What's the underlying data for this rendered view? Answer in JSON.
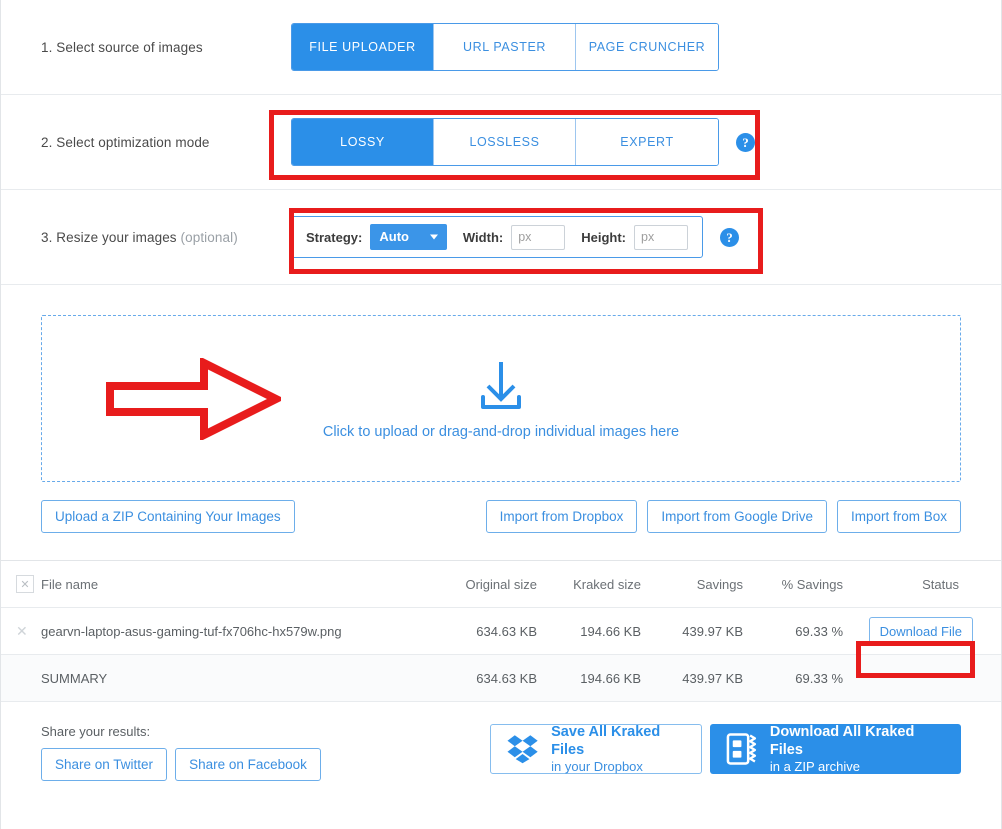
{
  "steps": [
    {
      "label_num": "1. Select source of images",
      "optional": "",
      "options": [
        "FILE UPLOADER",
        "URL PASTER",
        "PAGE CRUNCHER"
      ],
      "selected": "FILE UPLOADER"
    },
    {
      "label_num": "2. Select optimization mode",
      "optional": "",
      "options": [
        "LOSSY",
        "LOSSLESS",
        "EXPERT"
      ],
      "selected": "LOSSY",
      "help": "?"
    },
    {
      "label_num": "3. Resize your images",
      "optional": "(optional)",
      "help": "?"
    }
  ],
  "resize": {
    "strategy_label": "Strategy:",
    "strategy_value": "Auto",
    "width_label": "Width:",
    "width_value": "",
    "width_placeholder": "px",
    "height_label": "Height:",
    "height_value": "",
    "height_placeholder": "px"
  },
  "dropzone": {
    "text": "Click to upload or drag-and-drop individual images here",
    "icon": "download-arrow-icon"
  },
  "import_buttons": {
    "zip": "Upload a ZIP Containing Your Images",
    "dropbox": "Import from Dropbox",
    "google_drive": "Import from Google Drive",
    "box": "Import from Box"
  },
  "table": {
    "headers": {
      "file_name": "File name",
      "original_size": "Original size",
      "kraked_size": "Kraked size",
      "savings": "Savings",
      "pct_savings": "% Savings",
      "status": "Status"
    },
    "rows": [
      {
        "file_name": "gearvn-laptop-asus-gaming-tuf-fx706hc-hx579w.png",
        "original_size": "634.63 KB",
        "kraked_size": "194.66 KB",
        "savings": "439.97 KB",
        "pct_savings": "69.33 %",
        "status": "Download File"
      }
    ],
    "summary": {
      "label": "SUMMARY",
      "original_size": "634.63 KB",
      "kraked_size": "194.66 KB",
      "savings": "439.97 KB",
      "pct_savings": "69.33 %"
    }
  },
  "footer": {
    "share_title": "Share your results:",
    "share_twitter": "Share on Twitter",
    "share_facebook": "Share on Facebook",
    "dropbox_main": "Save All Kraked Files",
    "dropbox_sub": "in your Dropbox",
    "zip_main": "Download All Kraked Files",
    "zip_sub": "in a ZIP archive"
  },
  "colors": {
    "accent_blue": "#2b8fe8",
    "link_blue": "#3b8fe0",
    "annotation_red": "#e81c1c",
    "border_gray": "#e2e5e8"
  }
}
